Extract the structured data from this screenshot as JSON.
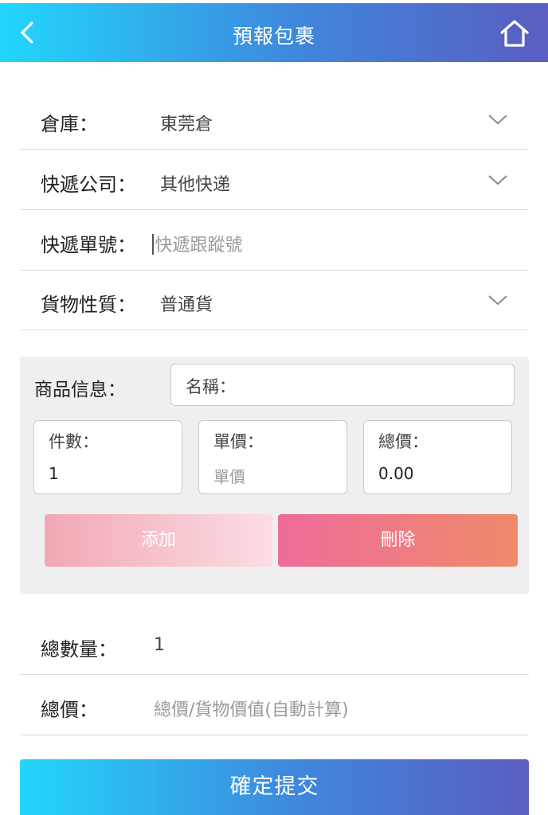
{
  "header": {
    "title": "預報包裹",
    "back_icon": "chevron-left-icon",
    "home_icon": "home-icon"
  },
  "form": {
    "warehouse": {
      "label": "倉庫：",
      "value": "東莞倉"
    },
    "courier": {
      "label": "快遞公司：",
      "value": "其他快递"
    },
    "tracking": {
      "label": "快遞單號：",
      "placeholder": "快遞跟蹤號"
    },
    "cargo_type": {
      "label": "貨物性質：",
      "value": "普通貨"
    }
  },
  "goods": {
    "label": "商品信息：",
    "name": {
      "label": "名稱："
    },
    "quantity": {
      "label": "件數：",
      "value": "1"
    },
    "unit_price": {
      "label": "單價：",
      "placeholder": "單價"
    },
    "total_price": {
      "label": "總價：",
      "value": "0.00"
    },
    "add_label": "添加",
    "delete_label": "刪除"
  },
  "summary": {
    "total_qty": {
      "label": "總數量：",
      "value": "1"
    },
    "total_price": {
      "label": "總價：",
      "placeholder": "總價/貨物價值(自動計算)"
    }
  },
  "submit_label": "確定提交",
  "colors": {
    "header_gradient_start": "#22d6fb",
    "header_gradient_end": "#5b5dc0",
    "add_button": "#f1a8b4",
    "delete_button": "#ee6c9a"
  }
}
